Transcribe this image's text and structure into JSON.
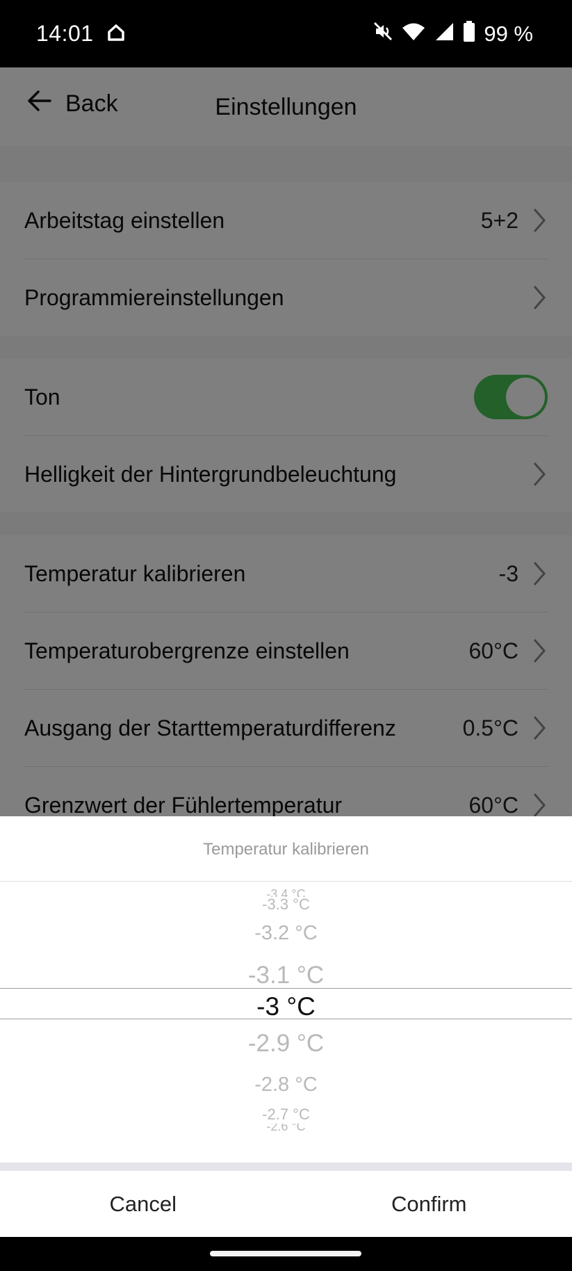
{
  "status": {
    "time": "14:01",
    "battery": "99 %"
  },
  "header": {
    "back_label": "Back",
    "title": "Einstellungen"
  },
  "settings": {
    "group1": [
      {
        "label": "Arbeitstag einstellen",
        "value": "5+2"
      },
      {
        "label": "Programmiereinstellungen",
        "value": ""
      }
    ],
    "group2": [
      {
        "label": "Ton",
        "toggle": true
      },
      {
        "label": "Helligkeit der Hintergrundbeleuchtung",
        "value": ""
      }
    ],
    "group3": [
      {
        "label": "Temperatur kalibrieren",
        "value": "-3"
      },
      {
        "label": "Temperaturobergrenze einstellen",
        "value": "60°C"
      },
      {
        "label": "Ausgang der Starttemperaturdifferenz",
        "value": "0.5°C"
      },
      {
        "label": "Grenzwert der Fühlertemperatur",
        "value": "60°C"
      }
    ]
  },
  "picker": {
    "title": "Temperatur kalibrieren",
    "options": [
      "-3.4 °C",
      "-3.3 °C",
      "-3.2 °C",
      "-3.1 °C",
      "-3 °C",
      "-2.9 °C",
      "-2.8 °C",
      "-2.7 °C",
      "-2.6 °C"
    ],
    "selected": "-3 °C",
    "cancel_label": "Cancel",
    "confirm_label": "Confirm"
  },
  "colors": {
    "toggle_on": "#46c054",
    "overlay": "rgba(0,0,0,0.5)"
  },
  "icons": [
    "home-icon",
    "mute-icon",
    "wifi-icon",
    "signal-icon",
    "battery-icon",
    "back-arrow-icon",
    "chevron-right-icon"
  ]
}
